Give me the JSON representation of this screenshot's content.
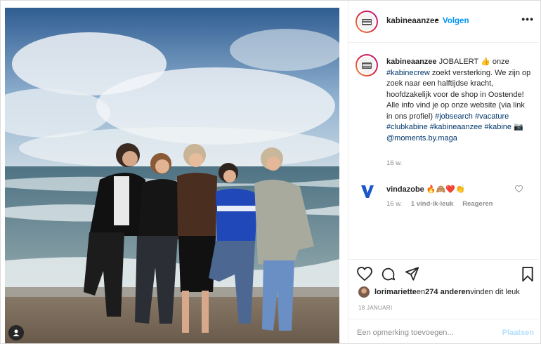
{
  "post": {
    "username": "kabineaanzee",
    "follow_label": "Volgen",
    "follow_separator": "•",
    "more_label": "•••"
  },
  "caption": {
    "username": "kabineaanzee",
    "text_1": " JOBALERT 👍 onze ",
    "tag_kabinecrew": "#kabinecrew",
    "text_2": " zoekt versterking. We zijn op zoek naar een halftijdse kracht, hoofdzakelijk voor de shop in Oostende! Alle info vind je op onze website (via link in ons profiel) ",
    "tag_jobsearch": "#jobsearch",
    "tag_vacature": "#vacature",
    "tag_clubkabine": "#clubkabine",
    "tag_kabineaanzee": "#kabineaanzee",
    "tag_kabine": "#kabine",
    "camera": " 📷 ",
    "mention": "@moments.by.maga",
    "time": "16 w."
  },
  "comment": {
    "username": "vindazobe",
    "text": " 🔥🙈❤️👏",
    "time": "16 w.",
    "likes": "1 vind-ik-leuk",
    "reply": "Reageren"
  },
  "likes": {
    "user": "lorimariette",
    "middle": " en ",
    "count": "274 anderen",
    "suffix": " vinden dit leuk"
  },
  "date": "18 JANUARI",
  "add_comment": {
    "placeholder": "Een opmerking toevoegen...",
    "post_label": "Plaatsen"
  },
  "icons": {
    "header_avatar": "kabine-logo-icon",
    "commenter_avatar": "v-logo-icon",
    "like": "heart-icon",
    "comment": "comment-icon",
    "share": "send-icon",
    "save": "bookmark-icon",
    "tag": "user-icon"
  },
  "colors": {
    "accent": "#0095f6",
    "link": "#00376b",
    "muted": "#8e8e8e",
    "disabled_post": "#b2dffc",
    "commenter_brand": "#1a57c9"
  }
}
